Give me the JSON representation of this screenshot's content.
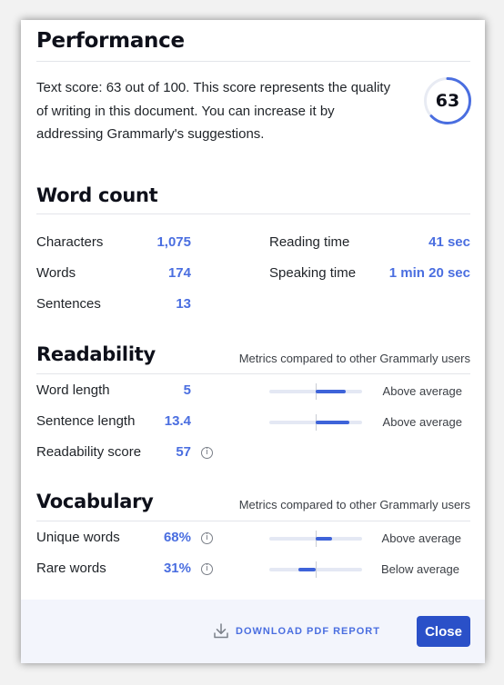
{
  "performance": {
    "title": "Performance",
    "description": "Text score: 63 out of 100. This score represents the quality of writing in this document. You can increase it by addressing Grammarly's suggestions.",
    "score": "63",
    "score_fraction": 0.63
  },
  "word_count": {
    "title": "Word count",
    "left": [
      {
        "label": "Characters",
        "value": "1,075"
      },
      {
        "label": "Words",
        "value": "174"
      },
      {
        "label": "Sentences",
        "value": "13"
      }
    ],
    "right": [
      {
        "label": "Reading time",
        "value": "41 sec"
      },
      {
        "label": "Speaking time",
        "value": "1 min 20 sec"
      }
    ]
  },
  "readability": {
    "title": "Readability",
    "note": "Metrics compared to other Grammarly users",
    "rows": [
      {
        "label": "Word length",
        "value": "5",
        "comparison": "Above average",
        "bar_start": 0.5,
        "bar_end": 0.82
      },
      {
        "label": "Sentence length",
        "value": "13.4",
        "comparison": "Above average",
        "bar_start": 0.5,
        "bar_end": 0.86
      },
      {
        "label": "Readability score",
        "value": "57",
        "info_icon": "info-icon"
      }
    ]
  },
  "vocabulary": {
    "title": "Vocabulary",
    "note": "Metrics compared to other Grammarly users",
    "rows": [
      {
        "label": "Unique words",
        "value": "68%",
        "comparison": "Above average",
        "bar_start": 0.5,
        "bar_end": 0.68
      },
      {
        "label": "Rare words",
        "value": "31%",
        "comparison": "Below average",
        "bar_start": 0.31,
        "bar_end": 0.5
      }
    ]
  },
  "footer": {
    "download_label": "DOWNLOAD PDF REPORT",
    "download_icon": "download-icon",
    "close_label": "Close"
  },
  "colors": {
    "accent": "#4a6ee0",
    "button": "#2a50c8",
    "bar_fill": "#3e63d9",
    "bar_track": "#e4e8f4"
  }
}
